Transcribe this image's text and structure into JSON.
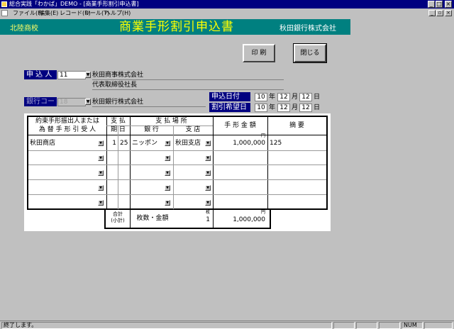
{
  "window": {
    "title": "総合実践「わかば」DEMO - [商業手形割引申込書]"
  },
  "menu": {
    "items": [
      "ファイル(F)",
      "編集(E)",
      "レコード(R)",
      "ツール(T)",
      "ヘルプ(H)"
    ]
  },
  "header": {
    "school": "北陸商校",
    "form_title": "商業手形割引申込書",
    "bank": "秋田銀行株式会社"
  },
  "buttons": {
    "print": "印 刷",
    "close": "閉じる"
  },
  "applicant": {
    "label": "申 込 人",
    "code": "11",
    "company": "秋田商事株式会社",
    "representative": "代表取締役社長"
  },
  "bank_code": {
    "label": "銀行コード",
    "code": "18",
    "name": "秋田銀行株式会社"
  },
  "dates": {
    "application": {
      "label": "申込日付",
      "year": "10",
      "month": "12",
      "day": "12"
    },
    "desired": {
      "label": "割引希望日",
      "year": "10",
      "month": "12",
      "day": "12"
    },
    "year_unit": "年",
    "month_unit": "月",
    "day_unit": "日"
  },
  "table": {
    "headers": {
      "recipient_line1": "約束手形振出人または",
      "recipient_line2": "為 替 手 形 引 受 人",
      "due_top": "支 払",
      "due_bottom": "期 日",
      "place_top": "支 払 場 所",
      "bank": "銀 行",
      "branch": "支 店",
      "amount": "手 形 金 額",
      "yen": "円",
      "memo": "摘 要"
    },
    "rows": [
      {
        "recipient": "秋田商店",
        "month": "1",
        "day": "25",
        "bank": "ニッポン",
        "branch": "秋田支店",
        "amount": "1,000,000",
        "memo": "125"
      },
      {
        "recipient": "",
        "month": "",
        "day": "",
        "bank": "",
        "branch": "",
        "amount": "",
        "memo": ""
      },
      {
        "recipient": "",
        "month": "",
        "day": "",
        "bank": "",
        "branch": "",
        "amount": "",
        "memo": ""
      },
      {
        "recipient": "",
        "month": "",
        "day": "",
        "bank": "",
        "branch": "",
        "amount": "",
        "memo": ""
      },
      {
        "recipient": "",
        "month": "",
        "day": "",
        "bank": "",
        "branch": "",
        "amount": "",
        "memo": ""
      }
    ],
    "total": {
      "label_top": "合計",
      "label_bottom": "(小計)",
      "caption": "枚数・金額",
      "count_unit": "枚",
      "count": "1",
      "yen": "円",
      "amount": "1,000,000"
    }
  },
  "status": {
    "text": "終了します。",
    "num": "NUM"
  },
  "colors": {
    "title_bar": "#000080",
    "header_band": "#008080",
    "title_text": "#ffff00",
    "label_bg": "#000080"
  }
}
